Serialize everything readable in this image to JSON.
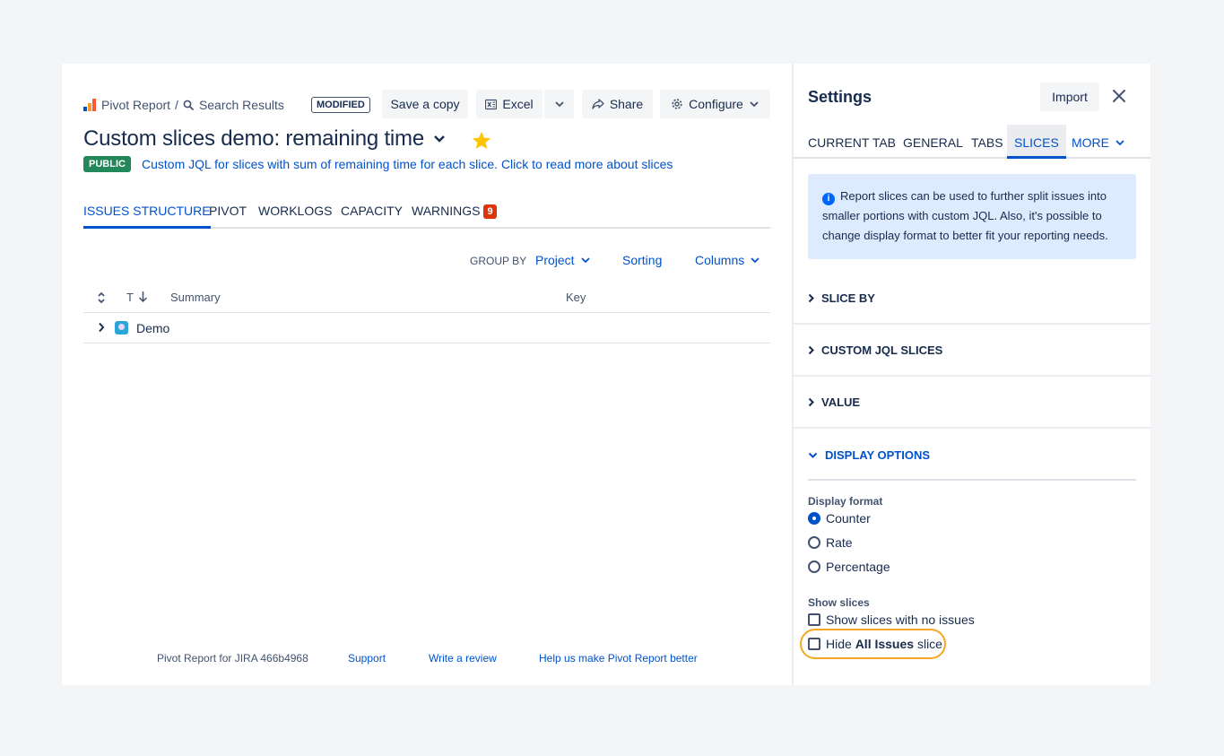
{
  "header": {
    "breadcrumb_app": "Pivot Report",
    "breadcrumb_sep": "/",
    "breadcrumb_search": "Search Results",
    "modified_badge": "MODIFIED",
    "save_copy_label": "Save a copy",
    "excel_label": "Excel",
    "share_label": "Share",
    "configure_label": "Configure"
  },
  "report": {
    "title": "Custom slices demo: remaining time",
    "public_badge": "PUBLIC",
    "description": "Custom JQL for slices with sum of remaining time for each slice. Click to read more about slices"
  },
  "tabs": {
    "issues_structure": "ISSUES STRUCTURE",
    "pivot": "PIVOT",
    "worklogs": "WORKLOGS",
    "capacity": "CAPACITY",
    "warnings": "WARNINGS",
    "warnings_count": "9"
  },
  "toolbar": {
    "group_by_label": "GROUP BY",
    "group_by_value": "Project",
    "sorting": "Sorting",
    "columns": "Columns"
  },
  "table": {
    "col_type": "T",
    "col_summary": "Summary",
    "col_key": "Key",
    "rows": [
      {
        "summary": "Demo"
      }
    ]
  },
  "footer": {
    "version": "Pivot Report for JIRA 466b4968",
    "support": "Support",
    "review": "Write a review",
    "feedback": "Help us make Pivot Report better"
  },
  "settings": {
    "title": "Settings",
    "import_label": "Import",
    "tabs": {
      "current_tab": "CURRENT TAB",
      "general": "GENERAL",
      "tabs": "TABS",
      "slices": "SLICES",
      "more": "MORE"
    },
    "info_text": "Report slices can be used to further split issues into smaller portions with custom JQL. Also, it's possible to change display format to better fit your reporting needs.",
    "sections": {
      "slice_by": "SLICE BY",
      "custom_jql": "CUSTOM JQL SLICES",
      "value": "VALUE",
      "display_options": "DISPLAY OPTIONS"
    },
    "display_format_label": "Display format",
    "formats": {
      "counter": "Counter",
      "rate": "Rate",
      "percentage": "Percentage"
    },
    "selected_format": "Counter",
    "show_slices_label": "Show slices",
    "show_empty_label": "Show slices with no issues",
    "hide_all_prefix": "Hide",
    "hide_all_bold": "All Issues",
    "hide_all_suffix": "slice"
  },
  "colors": {
    "accent": "#0052cc",
    "public_badge": "#22885a",
    "warning_badge": "#de350b",
    "highlight_ring": "#f5a623",
    "info_bg": "#deebff"
  }
}
